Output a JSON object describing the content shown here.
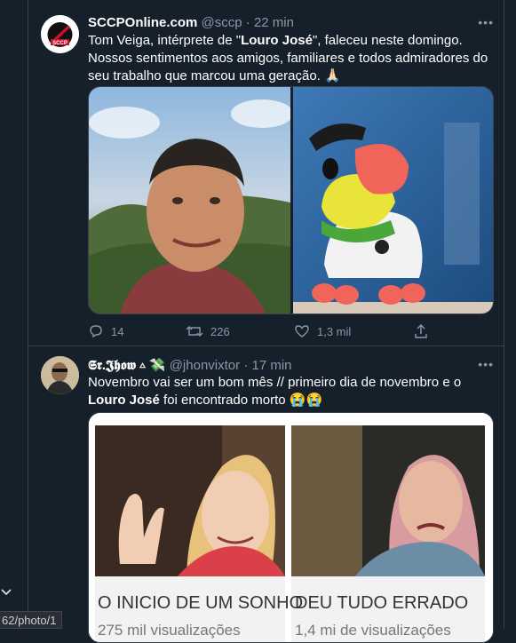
{
  "tweets": [
    {
      "name": "SCCPOnline.com",
      "handle": "@sccp",
      "time": "22 min",
      "avatar_label": "SCCP",
      "text_a": "Tom Veiga, intérprete de \"",
      "text_b": "Louro José",
      "text_c": "\", faleceu neste domingo. Nossos sentimentos aos amigos, familiares e todos admiradores do seu trabalho que marcou uma geração. 🙏🏻",
      "replies": "14",
      "retweets": "226",
      "likes": "1,3 mil"
    },
    {
      "name": "𝕾𝖗.𝕵𝖍𝖔𝖜 ▵",
      "name_emoji": "💸",
      "handle": "@jhonvixtor",
      "time": "17 min",
      "text_a": "Novembro vai ser um bom mês // primeiro dia de novembro e o ",
      "text_b": "Louro José",
      "text_c": " foi encontrado morto 😭😭",
      "caption_left": "O INICIO DE UM SONHO",
      "caption_right": "DEU TUDO ERRADO",
      "views_left": "275 mil visualizações",
      "views_right": "1,4 mi de visualizações"
    }
  ],
  "status_url": "62/photo/1",
  "colors": {
    "background": "#15202b",
    "border": "#38444d",
    "muted": "#8899a6",
    "text": "#ffffff"
  }
}
